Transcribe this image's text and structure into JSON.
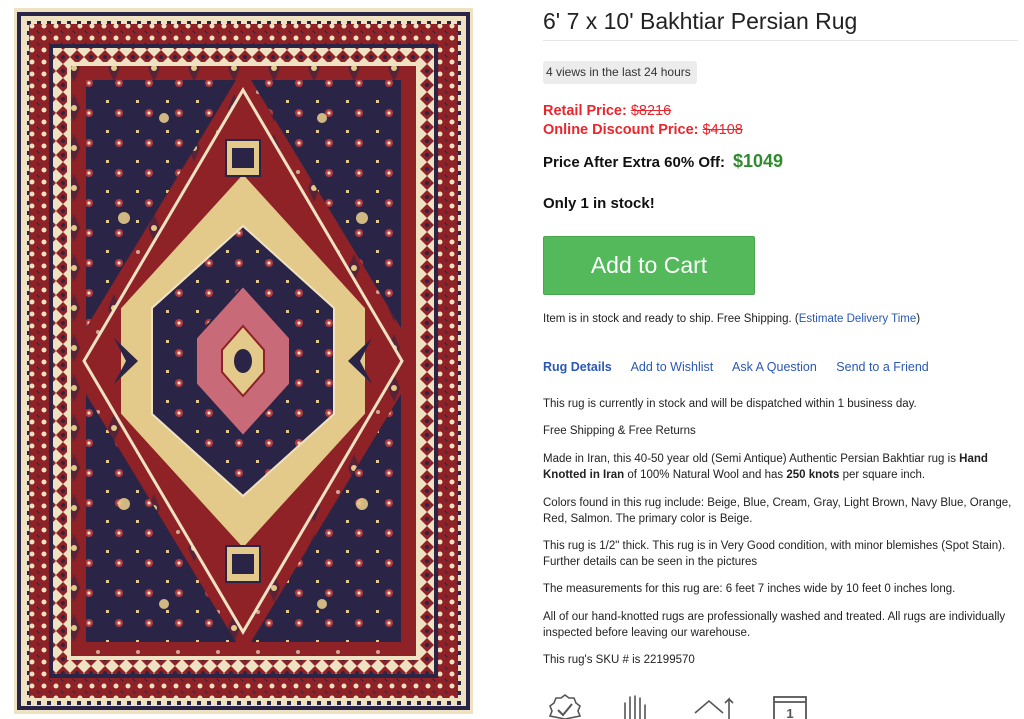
{
  "product": {
    "title": "6' 7 x 10' Bakhtiar Persian Rug",
    "views": "4 views in the last 24 hours",
    "retail_label": "Retail Price:",
    "retail_value": "$8216",
    "online_label": "Online Discount Price:",
    "online_value": "$4108",
    "after_label": "Price After Extra 60% Off:",
    "after_value": "$1049",
    "stock": "Only 1 in stock!",
    "add_to_cart": "Add to Cart",
    "ship_text": "Item is in stock and ready to ship. Free Shipping. (",
    "ship_link": "Estimate Delivery Time",
    "ship_close": ")"
  },
  "tabs": [
    "Rug Details",
    "Add to Wishlist",
    "Ask A Question",
    "Send to a Friend"
  ],
  "details": {
    "dispatch": "This rug is currently in stock and will be dispatched within 1 business day.",
    "shipping": "Free Shipping & Free Returns",
    "made_1": "Made in Iran, this 40-50 year old (Semi Antique) Authentic Persian Bakhtiar rug is ",
    "made_b1": "Hand Knotted in Iran",
    "made_2": " of 100% Natural Wool and has ",
    "made_b2": "250 knots",
    "made_3": " per square inch.",
    "colors": "Colors found in this rug include: Beige, Blue, Cream, Gray, Light Brown, Navy Blue, Orange, Red, Salmon. The primary color is Beige.",
    "condition": "This rug is 1/2\" thick. This rug is in Very Good condition, with minor blemishes (Spot Stain). Further details can be seen in the pictures",
    "measurements": "The measurements for this rug are: 6 feet 7 inches wide by 10 feet 0 inches long.",
    "washed": "All of our hand-knotted rugs are professionally washed and treated. All rugs are individually inspected before leaving our warehouse.",
    "sku": "This rug's SKU # is 22199570"
  },
  "icon_labels": {
    "calendar_day": "1"
  },
  "colors": {
    "retail_red": "#e8262c",
    "sale_green": "#2e8b2e",
    "cart_green": "#53b95a",
    "link_blue": "#2b58b3",
    "rug_red": "#8e2227",
    "rug_navy": "#2a2546",
    "rug_beige": "#e3c98a",
    "rug_cream": "#efe2c2"
  },
  "icons": [
    "rug-image",
    "checkmark-badge-icon",
    "hand-knotted-icon",
    "home-return-icon",
    "calendar-icon"
  ]
}
